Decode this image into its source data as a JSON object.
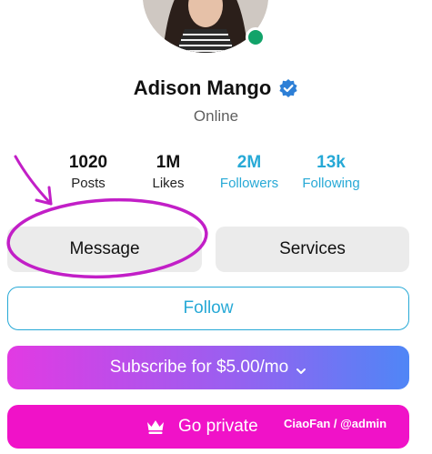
{
  "profile": {
    "name": "Adison Mango",
    "status": "Online",
    "verified_icon": "verified-badge-icon",
    "online_color": "#12a36a"
  },
  "stats": [
    {
      "value": "1020",
      "label": "Posts"
    },
    {
      "value": "1M",
      "label": "Likes"
    },
    {
      "value": "2M",
      "label": "Followers"
    },
    {
      "value": "13k",
      "label": "Following"
    }
  ],
  "actions": {
    "message_label": "Message",
    "services_label": "Services",
    "follow_label": "Follow",
    "subscribe_label": "Subscribe for $5.00/mo",
    "private_label": "Go private"
  },
  "watermark": "CiaoFan / @admin",
  "colors": {
    "accent": "#27a9d6",
    "private": "#f012c8",
    "annotation": "#c21fc7"
  }
}
